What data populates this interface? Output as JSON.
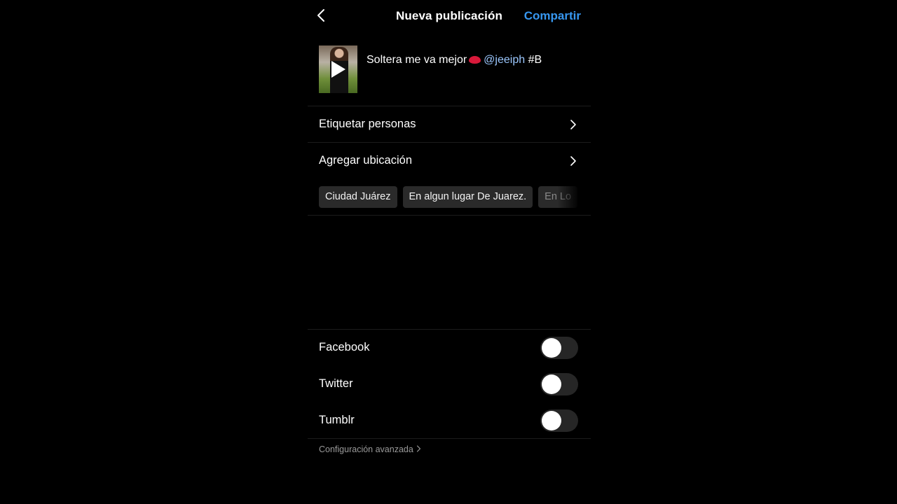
{
  "header": {
    "title": "Nueva publicación",
    "share_label": "Compartir"
  },
  "post": {
    "caption_text": "Soltera me va mejor",
    "caption_mention": "@jeeiph",
    "caption_tag": "#B"
  },
  "rows": {
    "tag_people": "Etiquetar personas",
    "add_location": "Agregar ubicación"
  },
  "location_suggestions": [
    "Ciudad Juárez",
    "En algun lugar De Juarez.",
    "En Lo"
  ],
  "share_to": [
    {
      "label": "Facebook",
      "enabled": false
    },
    {
      "label": "Twitter",
      "enabled": false
    },
    {
      "label": "Tumblr",
      "enabled": false
    }
  ],
  "advanced_settings": "Configuración avanzada",
  "colors": {
    "accent": "#3797f0",
    "mention": "#9cc8ff",
    "background": "#000000"
  }
}
